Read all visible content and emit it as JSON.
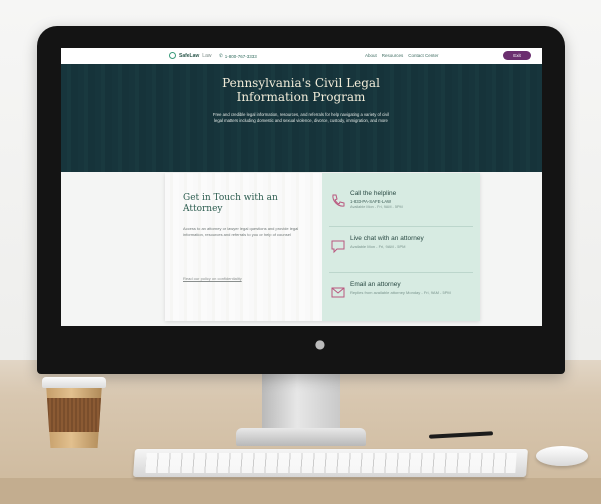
{
  "site": {
    "brand_name": "SafeLaw",
    "brand_suffix": "Law",
    "phone": "1-800-767-3333",
    "nav": [
      "About",
      "Resources",
      "Contact Center"
    ],
    "exit_label": "Exit"
  },
  "hero": {
    "title": "Pennsylvania's Civil Legal Information Program",
    "description": "Free and credible legal information, resources, and referrals for help navigating a variety of civil legal matters including domestic and sexual violence, divorce, custody, immigration, and more"
  },
  "contact": {
    "heading": "Get in Touch with an Attorney",
    "body": "Access to an attorney or lawyer legal questions and provide legal information, resources and referrals to you or help of counsel",
    "link": "Read our policy on confidentiality",
    "options": [
      {
        "icon": "phone-icon",
        "title": "Call the helpline",
        "line1": "1-833-PA-SAFE-LAW",
        "line2": "Available Mon - Fri, 9AM - 5PM"
      },
      {
        "icon": "chat-icon",
        "title": "Live chat with an attorney",
        "line1": "Available Mon - Fri, 9AM - 5PM",
        "line2": ""
      },
      {
        "icon": "mail-icon",
        "title": "Email an attorney",
        "line1": "Replies from available attorney Monday - Fri, 9AM - 5PM",
        "line2": ""
      }
    ]
  },
  "colors": {
    "hero_bg": "#20424a",
    "accent_purple": "#6b2f6f",
    "panel_green": "#d7ebe2",
    "heading_green": "#2d5d50"
  }
}
